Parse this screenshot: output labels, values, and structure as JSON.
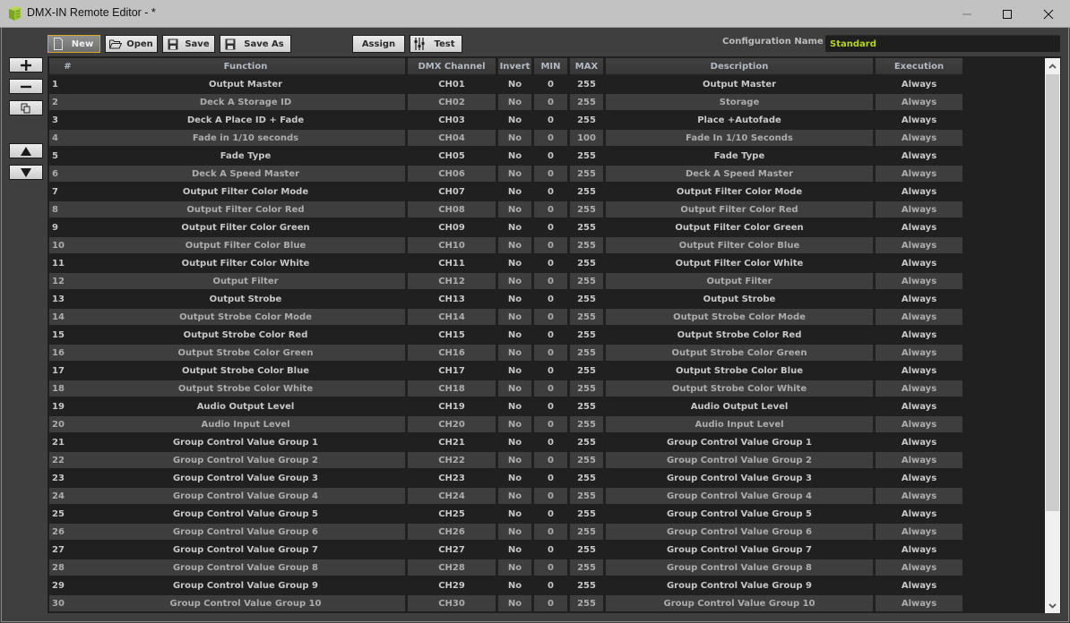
{
  "window": {
    "title": "DMX-IN Remote Editor - *",
    "icon": "cube-app-icon",
    "controls": [
      "minimize",
      "maximize",
      "close"
    ]
  },
  "toolbar": {
    "new_label": "New",
    "open_label": "Open",
    "save_label": "Save",
    "save_as_label": "Save As",
    "assign_label": "Assign",
    "test_label": "Test",
    "active_button": "New"
  },
  "config": {
    "label": "Configuration Name :",
    "value": "Standard",
    "value_color": "#b7d41b"
  },
  "side_buttons": {
    "add": "+",
    "remove": "−",
    "copy": "copy-icon",
    "move_up": "▲",
    "move_down": "▼"
  },
  "table": {
    "headers": {
      "num": "#",
      "function": "Function",
      "channel": "DMX Channel",
      "invert": "Invert",
      "min": "MIN",
      "max": "MAX",
      "description": "Description",
      "execution": "Execution"
    },
    "rows": [
      {
        "num": "1",
        "function": "Output Master",
        "channel": "CH01",
        "invert": "No",
        "min": "0",
        "max": "255",
        "description": "Output Master",
        "execution": "Always"
      },
      {
        "num": "2",
        "function": "Deck A Storage ID",
        "channel": "CH02",
        "invert": "No",
        "min": "0",
        "max": "255",
        "description": "Storage",
        "execution": "Always"
      },
      {
        "num": "3",
        "function": "Deck A Place ID + Fade",
        "channel": "CH03",
        "invert": "No",
        "min": "0",
        "max": "255",
        "description": "Place +Autofade",
        "execution": "Always"
      },
      {
        "num": "4",
        "function": "Fade in 1/10 seconds",
        "channel": "CH04",
        "invert": "No",
        "min": "0",
        "max": "100",
        "description": "Fade In 1/10 Seconds",
        "execution": "Always"
      },
      {
        "num": "5",
        "function": "Fade Type",
        "channel": "CH05",
        "invert": "No",
        "min": "0",
        "max": "255",
        "description": "Fade Type",
        "execution": "Always"
      },
      {
        "num": "6",
        "function": "Deck A Speed Master",
        "channel": "CH06",
        "invert": "No",
        "min": "0",
        "max": "255",
        "description": "Deck A Speed Master",
        "execution": "Always"
      },
      {
        "num": "7",
        "function": "Output Filter Color Mode",
        "channel": "CH07",
        "invert": "No",
        "min": "0",
        "max": "255",
        "description": "Output Filter Color Mode",
        "execution": "Always"
      },
      {
        "num": "8",
        "function": "Output Filter Color Red",
        "channel": "CH08",
        "invert": "No",
        "min": "0",
        "max": "255",
        "description": "Output Filter Color Red",
        "execution": "Always"
      },
      {
        "num": "9",
        "function": "Output Filter Color Green",
        "channel": "CH09",
        "invert": "No",
        "min": "0",
        "max": "255",
        "description": "Output Filter Color Green",
        "execution": "Always"
      },
      {
        "num": "10",
        "function": "Output Filter Color Blue",
        "channel": "CH10",
        "invert": "No",
        "min": "0",
        "max": "255",
        "description": "Output Filter Color Blue",
        "execution": "Always"
      },
      {
        "num": "11",
        "function": "Output Filter Color White",
        "channel": "CH11",
        "invert": "No",
        "min": "0",
        "max": "255",
        "description": "Output Filter Color White",
        "execution": "Always"
      },
      {
        "num": "12",
        "function": "Output Filter",
        "channel": "CH12",
        "invert": "No",
        "min": "0",
        "max": "255",
        "description": "Output Filter",
        "execution": "Always"
      },
      {
        "num": "13",
        "function": "Output Strobe",
        "channel": "CH13",
        "invert": "No",
        "min": "0",
        "max": "255",
        "description": "Output Strobe",
        "execution": "Always"
      },
      {
        "num": "14",
        "function": "Output Strobe Color Mode",
        "channel": "CH14",
        "invert": "No",
        "min": "0",
        "max": "255",
        "description": "Output Strobe Color Mode",
        "execution": "Always"
      },
      {
        "num": "15",
        "function": "Output Strobe Color Red",
        "channel": "CH15",
        "invert": "No",
        "min": "0",
        "max": "255",
        "description": "Output Strobe Color Red",
        "execution": "Always"
      },
      {
        "num": "16",
        "function": "Output Strobe Color Green",
        "channel": "CH16",
        "invert": "No",
        "min": "0",
        "max": "255",
        "description": "Output Strobe Color Green",
        "execution": "Always"
      },
      {
        "num": "17",
        "function": "Output Strobe Color Blue",
        "channel": "CH17",
        "invert": "No",
        "min": "0",
        "max": "255",
        "description": "Output Strobe Color Blue",
        "execution": "Always"
      },
      {
        "num": "18",
        "function": "Output Strobe Color White",
        "channel": "CH18",
        "invert": "No",
        "min": "0",
        "max": "255",
        "description": "Output Strobe Color White",
        "execution": "Always"
      },
      {
        "num": "19",
        "function": "Audio Output Level",
        "channel": "CH19",
        "invert": "No",
        "min": "0",
        "max": "255",
        "description": "Audio Output Level",
        "execution": "Always"
      },
      {
        "num": "20",
        "function": "Audio Input Level",
        "channel": "CH20",
        "invert": "No",
        "min": "0",
        "max": "255",
        "description": "Audio Input Level",
        "execution": "Always"
      },
      {
        "num": "21",
        "function": "Group Control Value Group 1",
        "channel": "CH21",
        "invert": "No",
        "min": "0",
        "max": "255",
        "description": "Group Control Value Group 1",
        "execution": "Always"
      },
      {
        "num": "22",
        "function": "Group Control Value Group 2",
        "channel": "CH22",
        "invert": "No",
        "min": "0",
        "max": "255",
        "description": "Group Control Value Group 2",
        "execution": "Always"
      },
      {
        "num": "23",
        "function": "Group Control Value Group 3",
        "channel": "CH23",
        "invert": "No",
        "min": "0",
        "max": "255",
        "description": "Group Control Value Group 3",
        "execution": "Always"
      },
      {
        "num": "24",
        "function": "Group Control Value Group 4",
        "channel": "CH24",
        "invert": "No",
        "min": "0",
        "max": "255",
        "description": "Group Control Value Group 4",
        "execution": "Always"
      },
      {
        "num": "25",
        "function": "Group Control Value Group 5",
        "channel": "CH25",
        "invert": "No",
        "min": "0",
        "max": "255",
        "description": "Group Control Value Group 5",
        "execution": "Always"
      },
      {
        "num": "26",
        "function": "Group Control Value Group 6",
        "channel": "CH26",
        "invert": "No",
        "min": "0",
        "max": "255",
        "description": "Group Control Value Group 6",
        "execution": "Always"
      },
      {
        "num": "27",
        "function": "Group Control Value Group 7",
        "channel": "CH27",
        "invert": "No",
        "min": "0",
        "max": "255",
        "description": "Group Control Value Group 7",
        "execution": "Always"
      },
      {
        "num": "28",
        "function": "Group Control Value Group 8",
        "channel": "CH28",
        "invert": "No",
        "min": "0",
        "max": "255",
        "description": "Group Control Value Group 8",
        "execution": "Always"
      },
      {
        "num": "29",
        "function": "Group Control Value Group 9",
        "channel": "CH29",
        "invert": "No",
        "min": "0",
        "max": "255",
        "description": "Group Control Value Group 9",
        "execution": "Always"
      },
      {
        "num": "30",
        "function": "Group Control Value Group 10",
        "channel": "CH30",
        "invert": "No",
        "min": "0",
        "max": "255",
        "description": "Group Control Value Group 10",
        "execution": "Always"
      }
    ]
  },
  "scrollbar": {
    "up_icon": "chevron-up-icon",
    "down_icon": "chevron-down-icon"
  }
}
